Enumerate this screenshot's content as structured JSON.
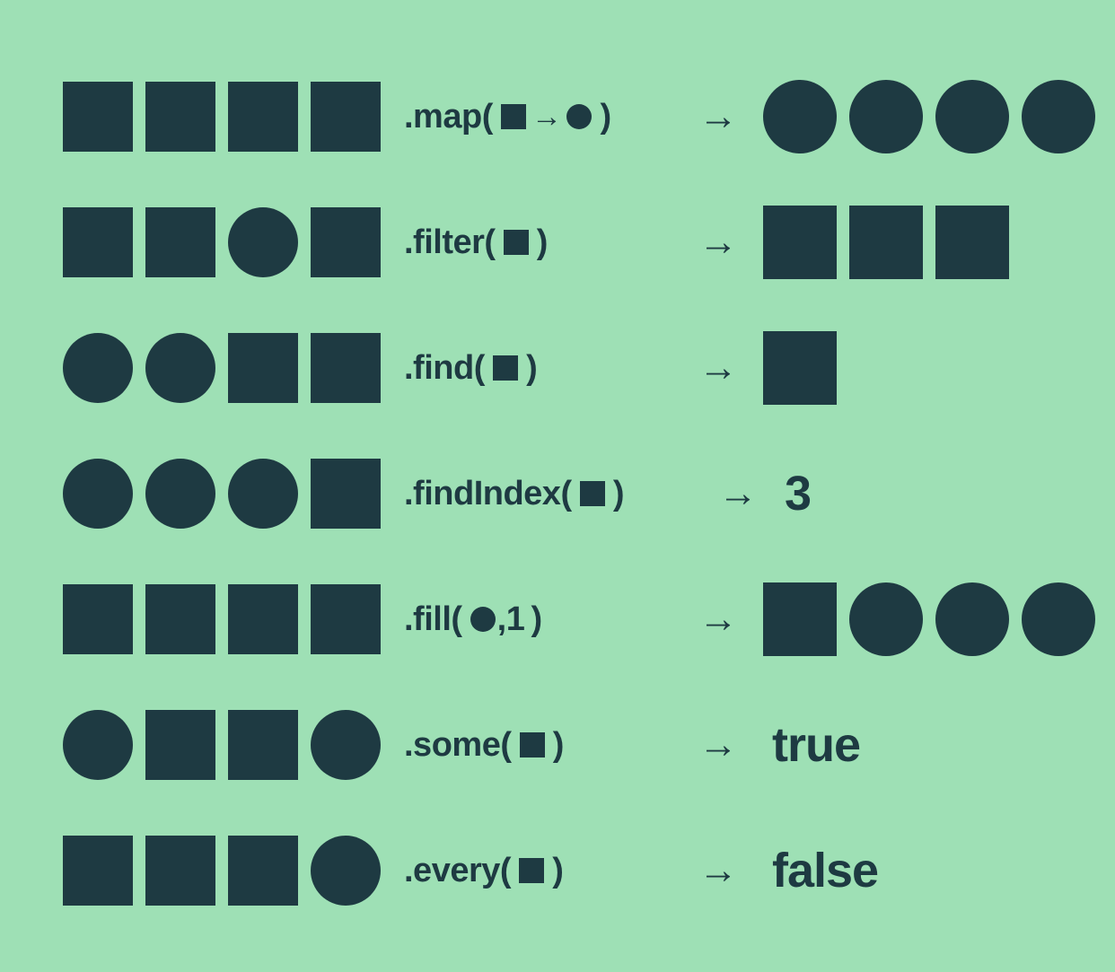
{
  "colors": {
    "bg": "#9ee0b5",
    "ink": "#1e3a42"
  },
  "arrow": "→",
  "rows": [
    {
      "input": [
        "square",
        "square",
        "square",
        "square"
      ],
      "method": {
        "name": ".map",
        "args": [
          {
            "t": "icon",
            "shape": "square"
          },
          {
            "t": "arrow"
          },
          {
            "t": "icon",
            "shape": "circle"
          }
        ]
      },
      "output": {
        "type": "shapes",
        "shapes": [
          "circle",
          "circle",
          "circle",
          "circle"
        ]
      }
    },
    {
      "input": [
        "square",
        "square",
        "circle",
        "square"
      ],
      "method": {
        "name": ".filter",
        "args": [
          {
            "t": "icon",
            "shape": "square"
          }
        ]
      },
      "output": {
        "type": "shapes",
        "shapes": [
          "square",
          "square",
          "square"
        ]
      }
    },
    {
      "input": [
        "circle",
        "circle",
        "square",
        "square"
      ],
      "method": {
        "name": ".find",
        "args": [
          {
            "t": "icon",
            "shape": "square"
          }
        ]
      },
      "output": {
        "type": "shapes",
        "shapes": [
          "square"
        ]
      }
    },
    {
      "input": [
        "circle",
        "circle",
        "circle",
        "square"
      ],
      "method": {
        "name": ".findIndex",
        "args": [
          {
            "t": "icon",
            "shape": "square"
          }
        ]
      },
      "output": {
        "type": "text",
        "text": "3"
      }
    },
    {
      "input": [
        "square",
        "square",
        "square",
        "square"
      ],
      "method": {
        "name": ".fill",
        "args": [
          {
            "t": "icon",
            "shape": "circle"
          },
          {
            "t": "text",
            "text": ",1"
          }
        ]
      },
      "output": {
        "type": "shapes",
        "shapes": [
          "square",
          "circle",
          "circle",
          "circle"
        ]
      }
    },
    {
      "input": [
        "circle",
        "square",
        "square",
        "circle"
      ],
      "method": {
        "name": ".some",
        "args": [
          {
            "t": "icon",
            "shape": "square"
          }
        ]
      },
      "output": {
        "type": "text",
        "text": "true"
      }
    },
    {
      "input": [
        "square",
        "square",
        "square",
        "circle"
      ],
      "method": {
        "name": ".every",
        "args": [
          {
            "t": "icon",
            "shape": "square"
          }
        ]
      },
      "output": {
        "type": "text",
        "text": "false"
      }
    }
  ]
}
